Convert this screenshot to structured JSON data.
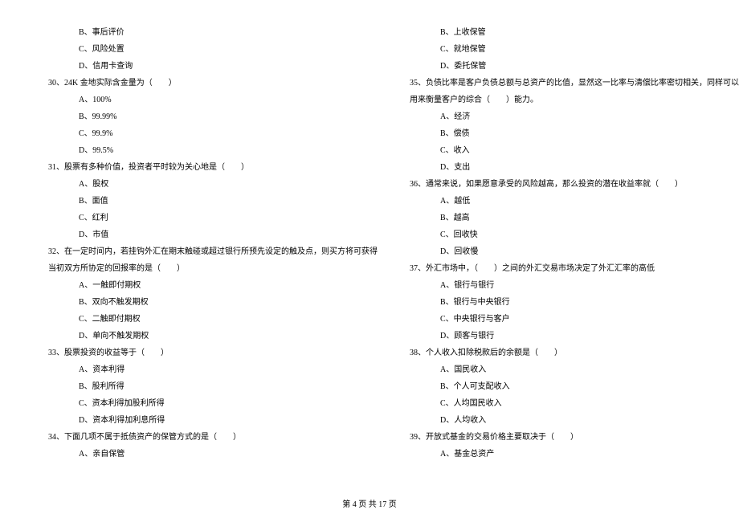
{
  "left": {
    "opts_pre": [
      "B、事后评价",
      "C、风险处置",
      "D、信用卡查询"
    ],
    "q30": "30、24K 金地实际含金量为（　　）",
    "q30_opts": [
      "A、100%",
      "B、99.99%",
      "C、99.9%",
      "D、99.5%"
    ],
    "q31": "31、股票有多种价值，投资者平时较为关心地是（　　）",
    "q31_opts": [
      "A、股权",
      "B、面值",
      "C、红利",
      "D、市值"
    ],
    "q32_a": "32、在一定时间内，若挂钩外汇在期末触碰或超过银行所预先设定的触及点，则买方将可获得",
    "q32_b": "当初双方所协定的回报率的是（　　）",
    "q32_opts": [
      "A、一触即付期权",
      "B、双向不触发期权",
      "C、二触即付期权",
      "D、单向不触发期权"
    ],
    "q33": "33、股票投资的收益等于（　　）",
    "q33_opts": [
      "A、资本利得",
      "B、股利所得",
      "C、资本利得加股利所得",
      "D、资本利得加利息所得"
    ],
    "q34": "34、下面几项不属于抵债资产的保管方式的是（　　）",
    "q34_opts": [
      "A、亲自保管"
    ]
  },
  "right": {
    "opts_pre": [
      "B、上收保管",
      "C、就地保管",
      "D、委托保管"
    ],
    "q35_a": "35、负债比率是客户负债总额与总资产的比值，显然这一比率与清偿比率密切相关，同样可以",
    "q35_b": "用来衡量客户的综合（　　）能力。",
    "q35_opts": [
      "A、经济",
      "B、偿债",
      "C、收入",
      "D、支出"
    ],
    "q36": "36、通常来说，如果愿意承受的风险越高，那么投资的潜在收益率就（　　）",
    "q36_opts": [
      "A、越低",
      "B、越高",
      "C、回收快",
      "D、回收慢"
    ],
    "q37": "37、外汇市场中，（　　）之间的外汇交易市场决定了外汇汇率的高低",
    "q37_opts": [
      "A、银行与银行",
      "B、银行与中央银行",
      "C、中央银行与客户",
      "D、顾客与银行"
    ],
    "q38": "38、个人收入扣除税款后的余额是（　　）",
    "q38_opts": [
      "A、国民收入",
      "B、个人可支配收入",
      "C、人均国民收入",
      "D、人均收入"
    ],
    "q39": "39、开放式基金的交易价格主要取决于（　　）",
    "q39_opts": [
      "A、基金总资产"
    ]
  },
  "footer": "第 4 页 共 17 页"
}
